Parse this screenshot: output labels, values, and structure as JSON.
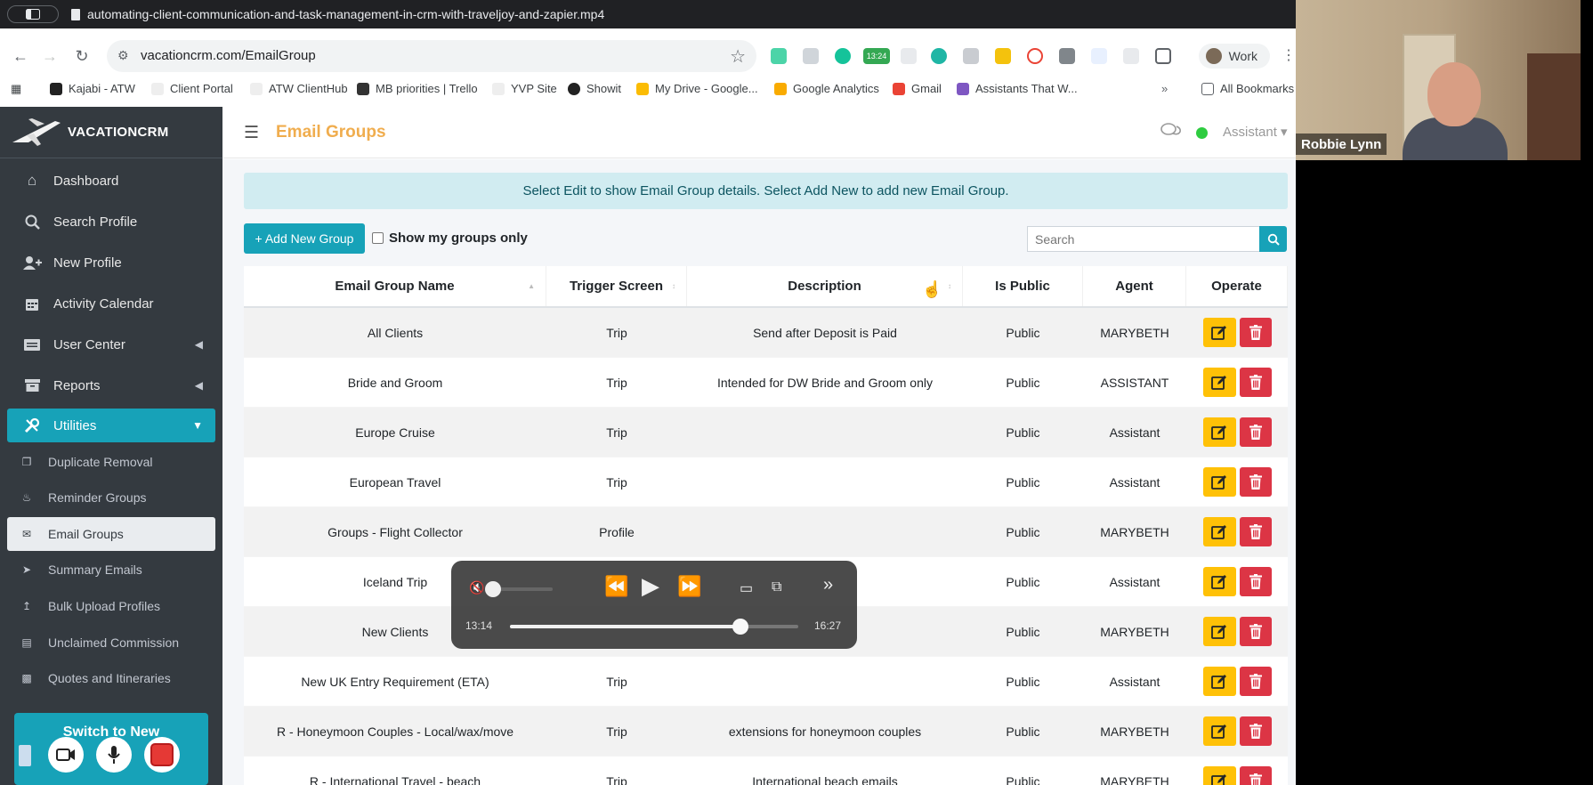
{
  "window": {
    "title": "automating-client-communication-and-task-management-in-crm-with-traveljoy-and-zapier.mp4"
  },
  "browser": {
    "url": "vacationcrm.com/EmailGroup",
    "profile": "Work",
    "bookmarks": [
      "Kajabi - ATW",
      "Client Portal",
      "ATW ClientHub",
      "MB priorities | Trello",
      "YVP Site",
      "Showit",
      "My Drive - Google...",
      "Google Analytics",
      "Gmail",
      "Assistants That W...",
      "All Bookmarks"
    ],
    "ext_badge": "13:24"
  },
  "crm": {
    "brand": "VACATIONCRM",
    "page_title": "Email Groups",
    "user": "Assistant",
    "nav": [
      {
        "label": "Dashboard",
        "icon": "home-icon"
      },
      {
        "label": "Search Profile",
        "icon": "search-icon"
      },
      {
        "label": "New Profile",
        "icon": "user-plus-icon"
      },
      {
        "label": "Activity Calendar",
        "icon": "calendar-icon"
      },
      {
        "label": "User Center",
        "icon": "id-card-icon"
      },
      {
        "label": "Reports",
        "icon": "archive-icon"
      },
      {
        "label": "Utilities",
        "icon": "tools-icon"
      }
    ],
    "subnav": [
      {
        "label": "Duplicate Removal",
        "icon": "copy-icon"
      },
      {
        "label": "Reminder Groups",
        "icon": "bell-icon"
      },
      {
        "label": "Email Groups",
        "icon": "envelope-icon"
      },
      {
        "label": "Summary Emails",
        "icon": "paper-plane-icon"
      },
      {
        "label": "Bulk Upload Profiles",
        "icon": "upload-icon"
      },
      {
        "label": "Unclaimed Commission",
        "icon": "money-icon"
      },
      {
        "label": "Quotes and Itineraries",
        "icon": "book-icon"
      }
    ],
    "switch_button": "Switch to New",
    "banner": "Select Edit to show Email Group details. Select Add New to add new Email Group.",
    "add_button": "+ Add New Group",
    "show_mine": "Show my groups only",
    "search_placeholder": "Search",
    "columns": [
      "Email Group Name",
      "Trigger Screen",
      "Description",
      "Is Public",
      "Agent",
      "Operate"
    ],
    "rows": [
      [
        "All Clients",
        "Trip",
        "Send after Deposit is Paid",
        "Public",
        "MARYBETH"
      ],
      [
        "Bride and Groom",
        "Trip",
        "Intended for DW Bride and Groom only",
        "Public",
        "ASSISTANT"
      ],
      [
        "Europe Cruise",
        "Trip",
        "",
        "Public",
        "Assistant"
      ],
      [
        "European Travel",
        "Trip",
        "",
        "Public",
        "Assistant"
      ],
      [
        "Groups - Flight Collector",
        "Profile",
        "",
        "Public",
        "MARYBETH"
      ],
      [
        "Iceland Trip",
        "",
        "",
        "Public",
        "Assistant"
      ],
      [
        "New Clients",
        "",
        "",
        "Public",
        "MARYBETH"
      ],
      [
        "New UK Entry Requirement (ETA)",
        "Trip",
        "",
        "Public",
        "Assistant"
      ],
      [
        "R - Honeymoon Couples - Local/wax/move",
        "Trip",
        "extensions for honeymoon couples",
        "Public",
        "MARYBETH"
      ],
      [
        "R - International Travel - beach",
        "Trip",
        "International beach emails",
        "Public",
        "MARYBETH"
      ]
    ]
  },
  "player": {
    "elapsed": "13:14",
    "total": "16:27",
    "progress": 0.8,
    "volume": 0.0
  },
  "webcam": {
    "name": "Robbie Lynn"
  },
  "colors": {
    "accent": "#17a2b8",
    "title": "#f0ad4e",
    "edit": "#ffc107",
    "delete": "#dc3545",
    "sidebar": "#343a40"
  }
}
